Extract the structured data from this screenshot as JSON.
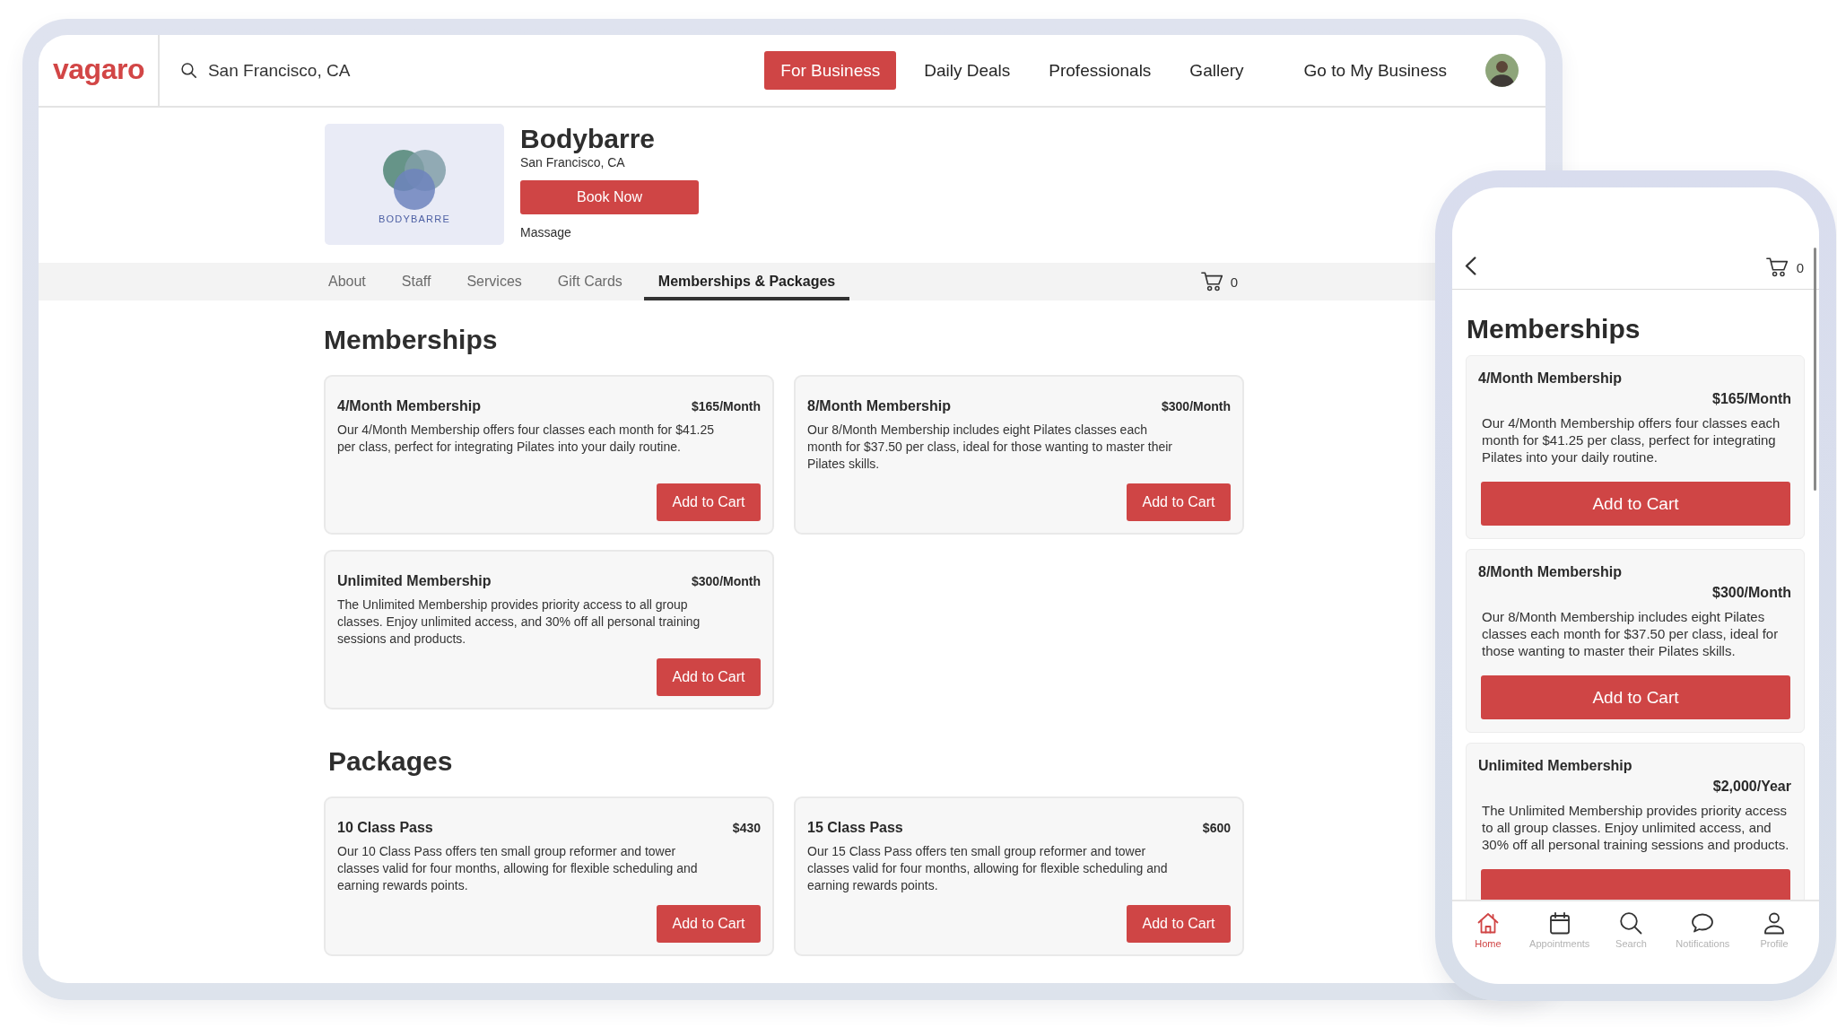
{
  "desktop": {
    "header": {
      "logo": "vagaro",
      "search": {
        "value": "San Francisco, CA"
      },
      "nav": [
        {
          "label": "For Business",
          "kind": "primary"
        },
        {
          "label": "Daily Deals",
          "kind": "link"
        },
        {
          "label": "Professionals",
          "kind": "link"
        },
        {
          "label": "Gallery",
          "kind": "link"
        },
        {
          "label": "Go to My Business",
          "kind": "link"
        }
      ]
    },
    "business": {
      "logo_text": "BODYBARRE",
      "name": "Bodybarre",
      "location": "San Francisco, CA",
      "book_button": "Book Now",
      "category": "Massage"
    },
    "tabs": [
      {
        "label": "About",
        "selected": false
      },
      {
        "label": "Staff",
        "selected": false
      },
      {
        "label": "Services",
        "selected": false
      },
      {
        "label": "Gift Cards",
        "selected": false
      },
      {
        "label": "Memberships & Packages",
        "selected": true
      }
    ],
    "cart_count": "0",
    "sections": [
      {
        "title": "Memberships",
        "items": [
          {
            "name": "4/Month Membership",
            "price": "$165/Month",
            "description": "Our 4/Month Membership offers four classes each month for $41.25 per class, perfect for integrating Pilates into your daily routine.",
            "button": "Add to Cart"
          },
          {
            "name": "8/Month Membership",
            "price": "$300/Month",
            "description": "Our 8/Month Membership includes eight Pilates classes each month for $37.50 per class, ideal for those wanting to master their Pilates skills.",
            "button": "Add to Cart"
          },
          {
            "name": "Unlimited Membership",
            "price": "$300/Month",
            "description": "The Unlimited Membership provides priority access to all group classes. Enjoy unlimited access, and 30% off all personal training sessions and products.",
            "button": "Add to Cart"
          }
        ]
      },
      {
        "title": "Packages",
        "items": [
          {
            "name": "10 Class Pass",
            "price": "$430",
            "description": "Our 10 Class Pass offers ten small group reformer and tower classes valid for four months, allowing for flexible scheduling and earning rewards points.",
            "button": "Add to Cart"
          },
          {
            "name": "15 Class Pass",
            "price": "$600",
            "description": "Our 15 Class Pass offers ten small group reformer and tower classes valid for four months, allowing for flexible scheduling and earning rewards points.",
            "button": "Add to Cart"
          }
        ]
      }
    ]
  },
  "mobile": {
    "cart_count": "0",
    "title": "Memberships",
    "items": [
      {
        "name": "4/Month Membership",
        "price": "$165/Month",
        "description": "Our 4/Month Membership offers four classes each month for $41.25 per class, perfect for integrating Pilates into your daily routine.",
        "button": "Add to Cart"
      },
      {
        "name": "8/Month Membership",
        "price": "$300/Month",
        "description": "Our 8/Month Membership includes eight Pilates classes each month for $37.50 per class, ideal for those wanting to master their Pilates skills.",
        "button": "Add to Cart"
      },
      {
        "name": "Unlimited Membership",
        "price": "$2,000/Year",
        "description": "The Unlimited Membership provides priority access to all group classes. Enjoy unlimited access, and 30% off all personal training sessions and products."
      }
    ],
    "bottom_nav": [
      {
        "label": "Home",
        "selected": true
      },
      {
        "label": "Appointments",
        "selected": false
      },
      {
        "label": "Search",
        "selected": false
      },
      {
        "label": "Notifications",
        "selected": false
      },
      {
        "label": "Profile",
        "selected": false
      }
    ]
  }
}
